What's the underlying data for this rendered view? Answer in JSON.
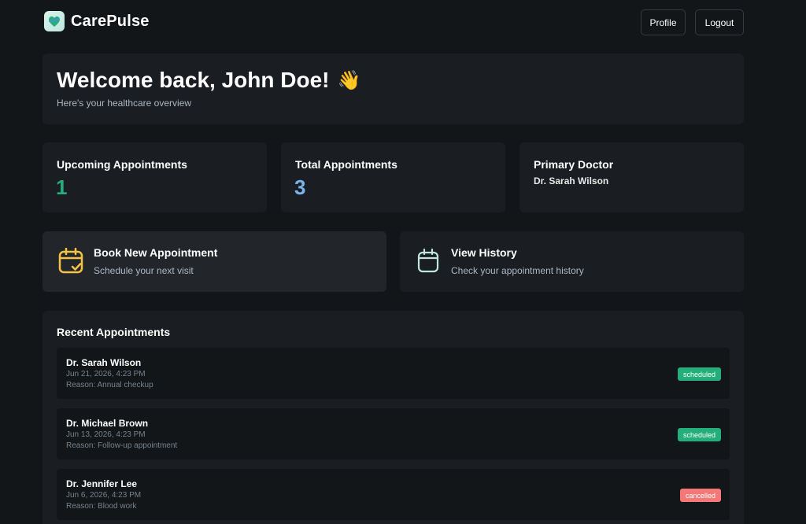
{
  "header": {
    "brand": "CarePulse",
    "profile_label": "Profile",
    "logout_label": "Logout"
  },
  "welcome": {
    "title": "Welcome back, John Doe!",
    "emoji": "👋",
    "subtitle": "Here's your healthcare overview"
  },
  "stats": [
    {
      "label": "Upcoming Appointments",
      "value": "1"
    },
    {
      "label": "Total Appointments",
      "value": "3"
    },
    {
      "label": "Primary Doctor",
      "value": "Dr. Sarah Wilson"
    }
  ],
  "actions": [
    {
      "title": "Book New Appointment",
      "subtitle": "Schedule your next visit",
      "icon": "calendar-check-icon"
    },
    {
      "title": "View History",
      "subtitle": "Check your appointment history",
      "icon": "calendar-icon"
    }
  ],
  "recent": {
    "title": "Recent Appointments",
    "items": [
      {
        "doctor": "Dr. Sarah Wilson",
        "date": "Jun 21, 2026, 4:23 PM",
        "reason": "Reason: Annual checkup",
        "status": "scheduled"
      },
      {
        "doctor": "Dr. Michael Brown",
        "date": "Jun 13, 2026, 4:23 PM",
        "reason": "Reason: Follow-up appointment",
        "status": "scheduled"
      },
      {
        "doctor": "Dr. Jennifer Lee",
        "date": "Jun 6, 2026, 4:23 PM",
        "reason": "Reason: Blood work",
        "status": "cancelled"
      }
    ]
  },
  "colors": {
    "background": "#131619",
    "card": "#1a1d21",
    "green": "#24ae7c",
    "blue": "#79b5ec",
    "red": "#f37877",
    "yellow": "#f5c344"
  }
}
